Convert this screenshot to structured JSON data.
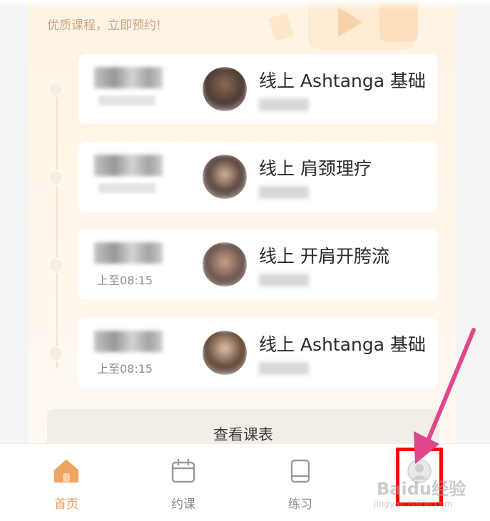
{
  "header": {
    "title": "",
    "subtitle": "优质课程，立即预约!"
  },
  "courses": [
    {
      "title": "线上 Ashtanga 基础",
      "time_end": ""
    },
    {
      "title": "线上 肩颈理疗",
      "time_end": ""
    },
    {
      "title": "线上 开肩开胯流",
      "time_end": "上至08:15"
    },
    {
      "title": "线上 Ashtanga 基础",
      "time_end": "上至08:15"
    }
  ],
  "schedule_button": {
    "label": "查看课表"
  },
  "bottom_nav": {
    "items": [
      {
        "label": "首页",
        "icon": "home-icon",
        "active": true
      },
      {
        "label": "约课",
        "icon": "calendar-icon",
        "active": false
      },
      {
        "label": "练习",
        "icon": "book-icon",
        "active": false
      },
      {
        "label": "",
        "icon": "profile-avatar-icon",
        "active": false
      }
    ]
  },
  "watermark": {
    "brand": "Baidu经验",
    "url": "jingyan.baidu.com"
  },
  "colors": {
    "accent": "#ee9a52",
    "card_bg": "#fff3e2",
    "highlight": "#ff0000",
    "arrow": "#e0468a"
  }
}
